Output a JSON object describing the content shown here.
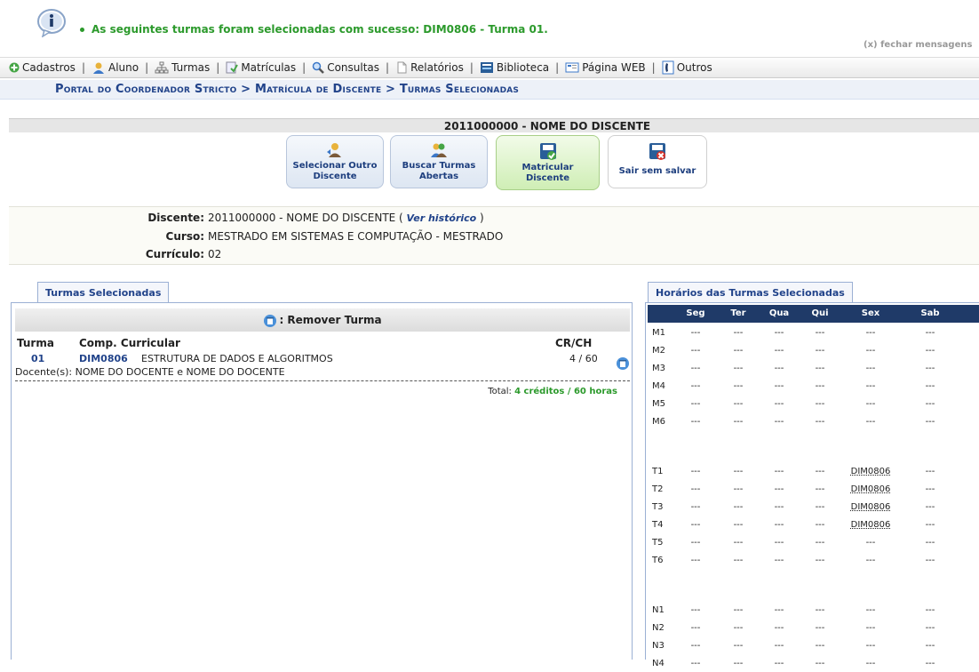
{
  "message": {
    "text": "As seguintes turmas foram selecionadas com sucesso: DIM0806 - Turma 01.",
    "close": "(x) fechar mensagens"
  },
  "menu": [
    {
      "label": "Cadastros",
      "icon": "plus-circle-icon"
    },
    {
      "label": "Aluno",
      "icon": "student-icon"
    },
    {
      "label": "Turmas",
      "icon": "network-icon"
    },
    {
      "label": "Matrículas",
      "icon": "enroll-icon"
    },
    {
      "label": "Consultas",
      "icon": "magnifier-icon"
    },
    {
      "label": "Relatórios",
      "icon": "document-icon"
    },
    {
      "label": "Biblioteca",
      "icon": "library-icon"
    },
    {
      "label": "Página WEB",
      "icon": "web-icon"
    },
    {
      "label": "Outros",
      "icon": "phone-icon"
    }
  ],
  "breadcrumb": "Portal do Coordenador Stricto > Matrícula de Discente > Turmas Selecionadas",
  "student_header": "2011000000 - NOME DO DISCENTE",
  "actions": [
    {
      "label_1": "Selecionar Outro",
      "label_2": "Discente"
    },
    {
      "label_1": "Buscar Turmas",
      "label_2": "Abertas"
    },
    {
      "label_1": "Matricular",
      "label_2": "Discente"
    },
    {
      "label_1": "Sair sem salvar",
      "label_2": ""
    }
  ],
  "info": {
    "discente_label": "Discente:",
    "discente_value": "2011000000 - NOME DO DISCENTE",
    "historico_link": "Ver histórico",
    "curso_label": "Curso:",
    "curso_value": "MESTRADO EM SISTEMAS E COMPUTAÇÃO - MESTRADO",
    "curriculo_label": "Currículo:",
    "curriculo_value": "02"
  },
  "left_panel": {
    "tab": "Turmas Selecionadas",
    "remove_label": ": Remover Turma",
    "columns": {
      "turma": "Turma",
      "comp": "Comp. Curricular",
      "crch": "CR/CH"
    },
    "row": {
      "turma": "01",
      "code": "DIM0806",
      "name": "ESTRUTURA DE DADOS E ALGORITMOS",
      "crch": "4 / 60"
    },
    "docente": "Docente(s): NOME DO DOCENTE e NOME DO DOCENTE",
    "total_prefix": "Total: ",
    "total_value": "4 créditos / 60 horas"
  },
  "schedule": {
    "tab": "Horários das Turmas Selecionadas",
    "days": [
      "Seg",
      "Ter",
      "Qua",
      "Qui",
      "Sex",
      "Sab"
    ],
    "empty": "---",
    "rows": [
      {
        "slot": "M1",
        "cells": [
          "---",
          "---",
          "---",
          "---",
          "---",
          "---"
        ]
      },
      {
        "slot": "M2",
        "cells": [
          "---",
          "---",
          "---",
          "---",
          "---",
          "---"
        ]
      },
      {
        "slot": "M3",
        "cells": [
          "---",
          "---",
          "---",
          "---",
          "---",
          "---"
        ]
      },
      {
        "slot": "M4",
        "cells": [
          "---",
          "---",
          "---",
          "---",
          "---",
          "---"
        ]
      },
      {
        "slot": "M5",
        "cells": [
          "---",
          "---",
          "---",
          "---",
          "---",
          "---"
        ]
      },
      {
        "slot": "M6",
        "cells": [
          "---",
          "---",
          "---",
          "---",
          "---",
          "---"
        ]
      },
      {
        "slot": "T1",
        "cells": [
          "---",
          "---",
          "---",
          "---",
          "DIM0806",
          "---"
        ]
      },
      {
        "slot": "T2",
        "cells": [
          "---",
          "---",
          "---",
          "---",
          "DIM0806",
          "---"
        ]
      },
      {
        "slot": "T3",
        "cells": [
          "---",
          "---",
          "---",
          "---",
          "DIM0806",
          "---"
        ]
      },
      {
        "slot": "T4",
        "cells": [
          "---",
          "---",
          "---",
          "---",
          "DIM0806",
          "---"
        ]
      },
      {
        "slot": "T5",
        "cells": [
          "---",
          "---",
          "---",
          "---",
          "---",
          "---"
        ]
      },
      {
        "slot": "T6",
        "cells": [
          "---",
          "---",
          "---",
          "---",
          "---",
          "---"
        ]
      },
      {
        "slot": "N1",
        "cells": [
          "---",
          "---",
          "---",
          "---",
          "---",
          "---"
        ]
      },
      {
        "slot": "N2",
        "cells": [
          "---",
          "---",
          "---",
          "---",
          "---",
          "---"
        ]
      },
      {
        "slot": "N3",
        "cells": [
          "---",
          "---",
          "---",
          "---",
          "---",
          "---"
        ]
      },
      {
        "slot": "N4",
        "cells": [
          "---",
          "---",
          "---",
          "---",
          "---",
          "---"
        ]
      }
    ]
  },
  "colors": {
    "success": "#2c9a2c",
    "link": "#21438a",
    "schedule_header": "#1f3a68"
  }
}
